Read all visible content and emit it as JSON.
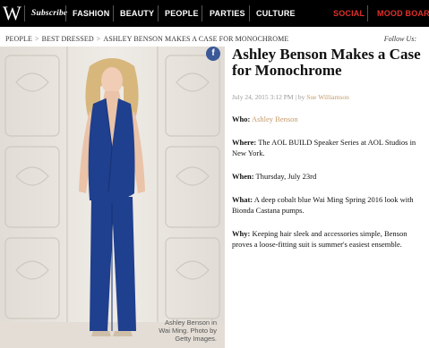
{
  "nav": {
    "logo": "W",
    "subscribe": "Subscribe",
    "items": [
      "FASHION",
      "BEAUTY",
      "PEOPLE",
      "PARTIES",
      "CULTURE"
    ],
    "social": "SOCIAL",
    "mood_board": "MOOD BOARD"
  },
  "breadcrumb": {
    "items": [
      "PEOPLE",
      "BEST DRESSED",
      "ASHLEY BENSON MAKES A CASE FOR MONOCHROME"
    ],
    "separator": ">",
    "follow_label": "Follow Us:"
  },
  "photo": {
    "share_icon": "facebook-icon",
    "share_glyph": "f",
    "caption": "Ashley Benson in Wai Ming. Photo by Getty Images."
  },
  "article": {
    "title": "Ashley Benson Makes a Case for Monochrome",
    "date": "July 24, 2015 3:12 PM",
    "by": "by",
    "author": "Sue Williamson",
    "who_label": "Who:",
    "who_value": "Ashley Benson",
    "where_label": "Where:",
    "where_value": "The AOL BUILD Speaker Series at AOL Studios in New York.",
    "when_label": "When:",
    "when_value": "Thursday, July 23rd",
    "what_label": "What:",
    "what_value": "A deep cobalt blue Wai Ming Spring 2016 look with Bionda Castana pumps.",
    "why_label": "Why:",
    "why_value": "Keeping hair sleek and accessories simple, Benson proves a loose-fitting suit is summer's easiest ensemble."
  },
  "colors": {
    "nav_bg": "#000000",
    "accent_red": "#e2302a",
    "author_gold": "#c59a6a",
    "suit_blue": "#1f3f8f",
    "facebook_blue": "#3b5998"
  }
}
